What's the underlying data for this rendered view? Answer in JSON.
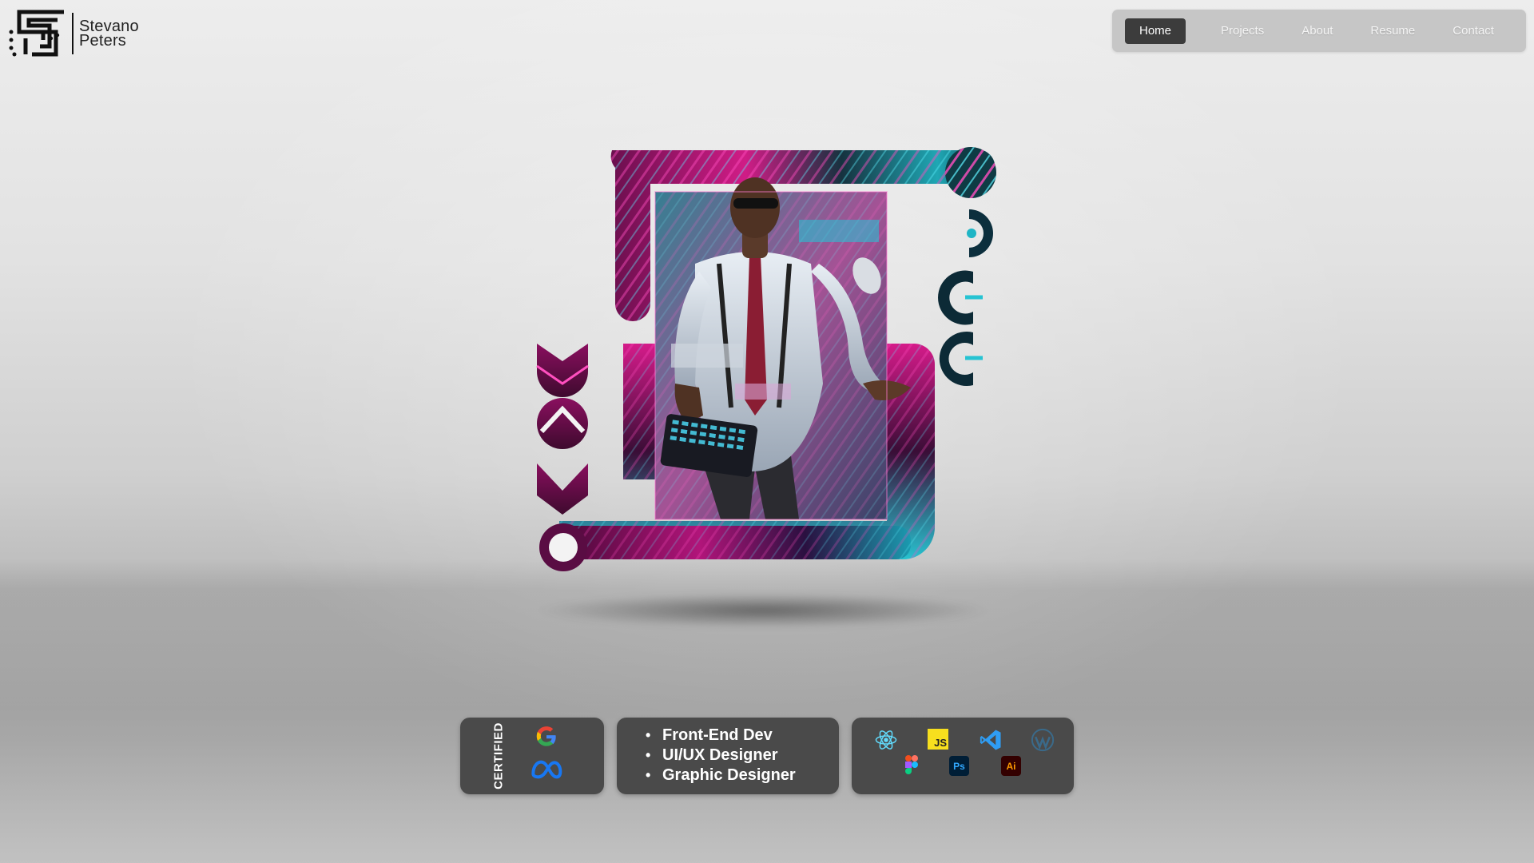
{
  "brand": {
    "name_first": "Stevano",
    "name_last": "Peters",
    "logo_icon": "sp-monogram-logo"
  },
  "nav": {
    "items": [
      {
        "label": "Home",
        "active": true
      },
      {
        "label": "Projects",
        "active": false
      },
      {
        "label": "About",
        "active": false
      },
      {
        "label": "Resume",
        "active": false
      },
      {
        "label": "Contact",
        "active": false
      }
    ]
  },
  "hero": {
    "image": "portrait-neon-s-frame",
    "accent_colors": [
      "#e0208f",
      "#2fd1d8",
      "#7a0c52"
    ]
  },
  "certified": {
    "label": "CERTIFIED",
    "icons": [
      "google-icon",
      "meta-icon"
    ]
  },
  "roles": {
    "items": [
      "Front-End Dev",
      "UI/UX Designer",
      "Graphic Designer"
    ]
  },
  "tools": {
    "icons": [
      "react-icon",
      "javascript-icon",
      "vscode-icon",
      "wordpress-icon",
      "figma-icon",
      "photoshop-icon",
      "illustrator-icon"
    ],
    "js_text": "JS",
    "ps_text": "Ps",
    "ai_text": "Ai"
  }
}
